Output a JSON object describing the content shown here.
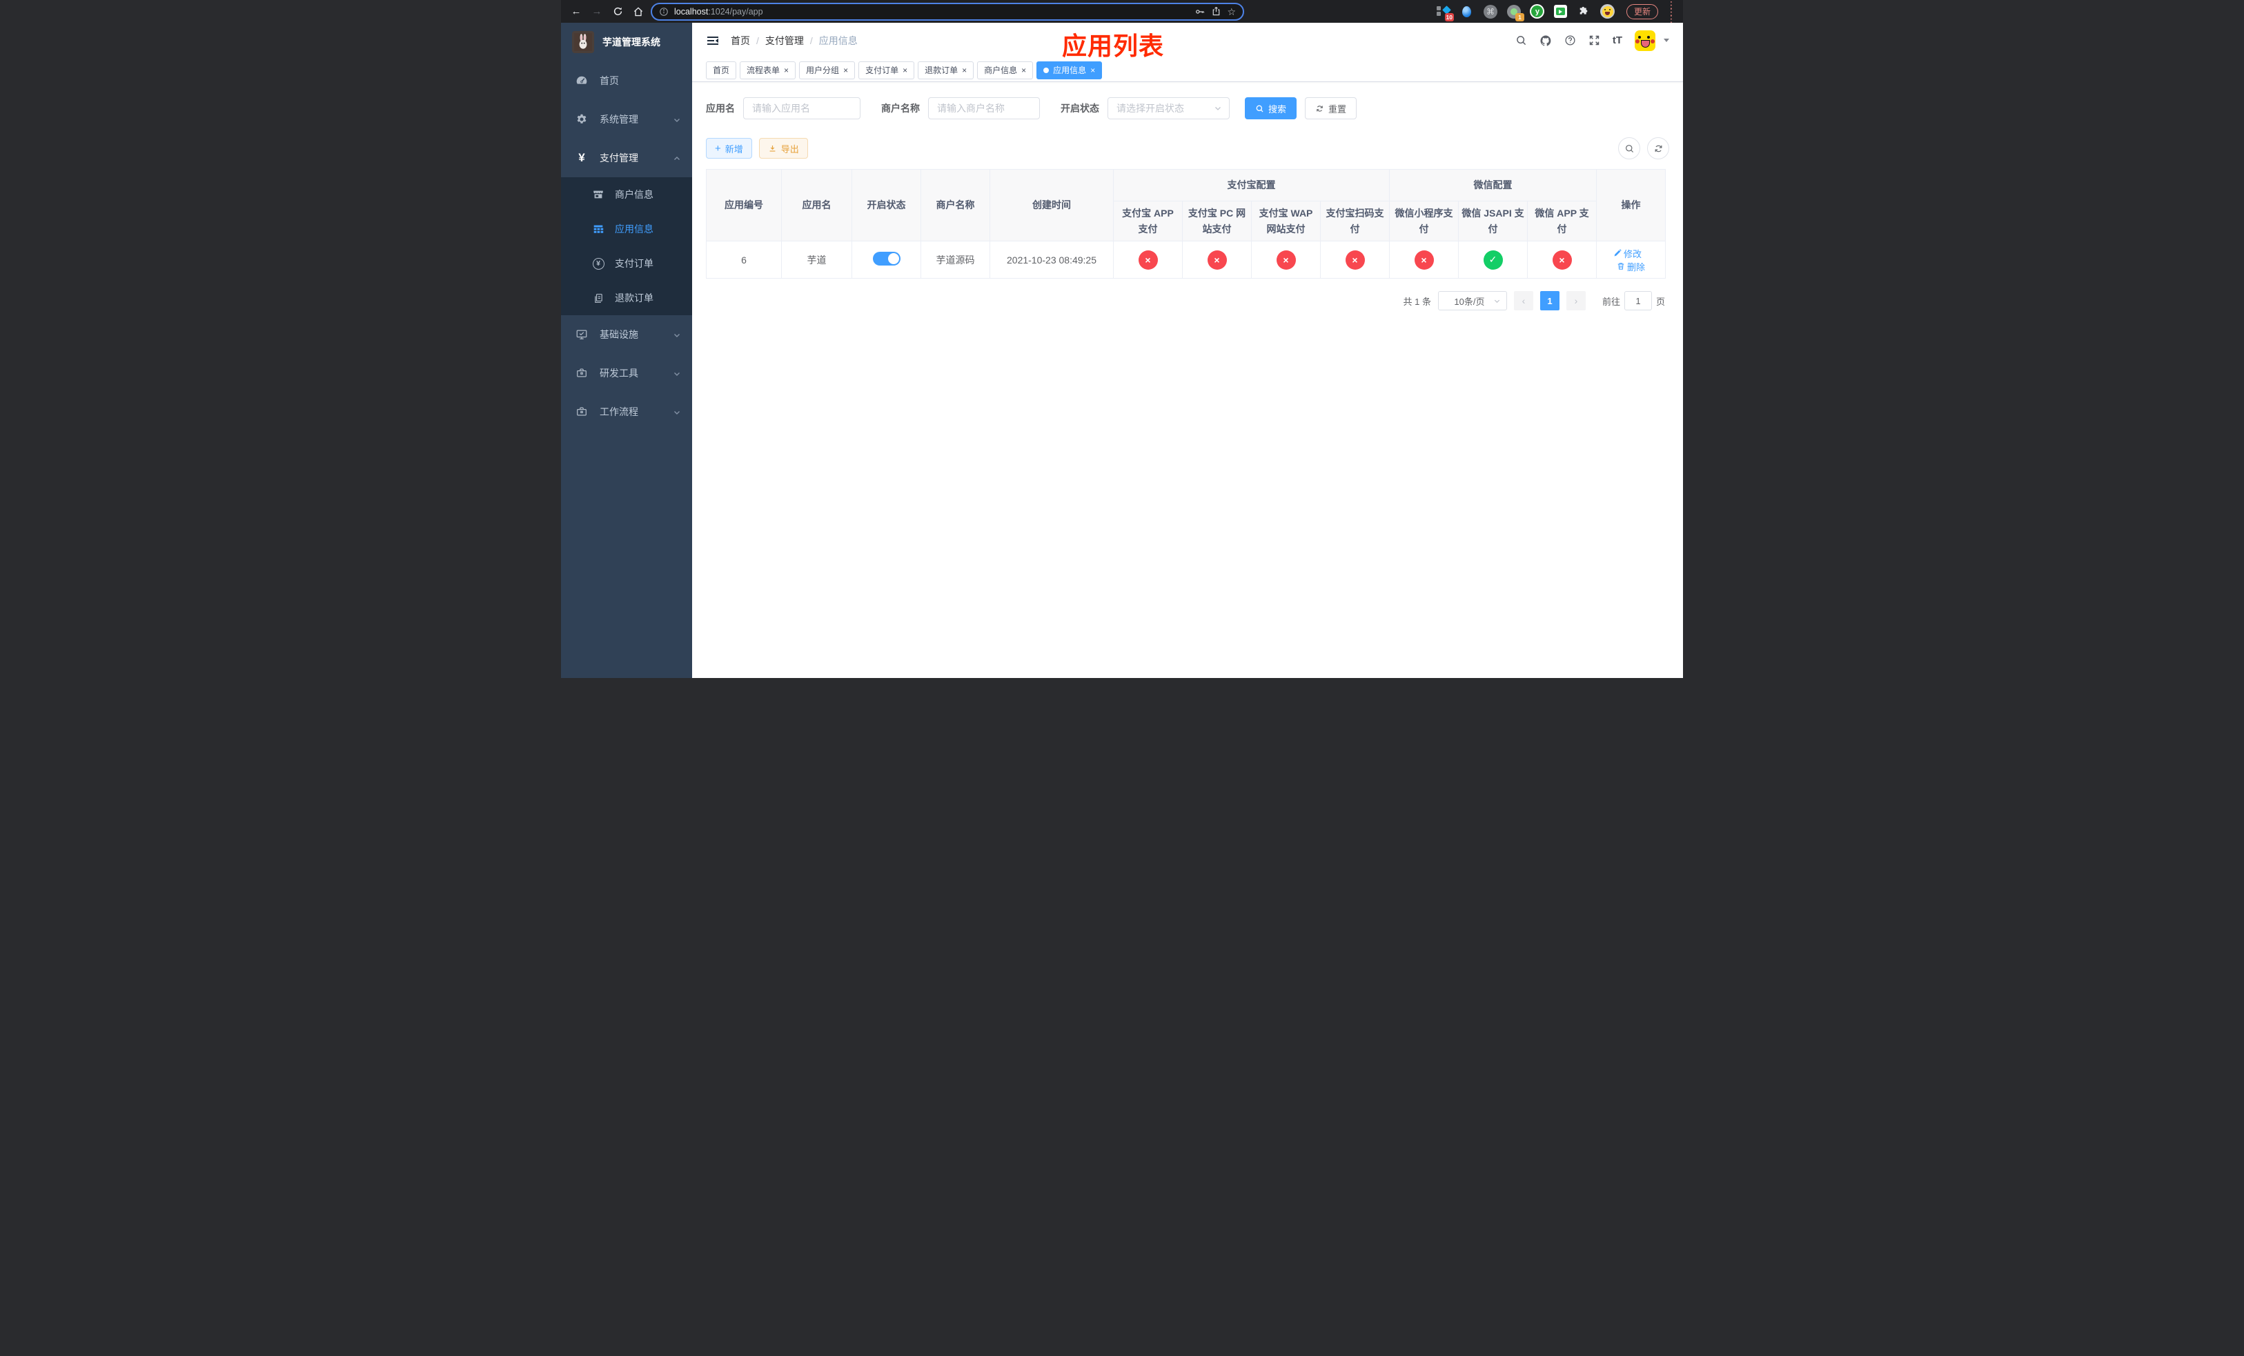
{
  "colors": {
    "primary": "#409EFF",
    "success": "#13CE66",
    "danger": "#F8474F",
    "warning": "#E6A23C",
    "annotation": "#FF2B00",
    "sidebar_bg": "#304156",
    "submenu_bg": "#1F2D3D",
    "chrome_bg": "#202124"
  },
  "browser": {
    "url_host": "localhost",
    "url_rest": ":1024/pay/app",
    "update_label": "更新",
    "extensions": {
      "badge_first": "10",
      "badge_target": "1",
      "y_letter": "y",
      "cmd_glyph": "⌘"
    }
  },
  "sidebar": {
    "title": "芋道管理系统",
    "items": [
      {
        "label": "首页"
      },
      {
        "label": "系统管理"
      },
      {
        "label": "支付管理"
      },
      {
        "label": "基础设施"
      },
      {
        "label": "研发工具"
      },
      {
        "label": "工作流程"
      }
    ],
    "pay_children": [
      {
        "label": "商户信息"
      },
      {
        "label": "应用信息"
      },
      {
        "label": "支付订单"
      },
      {
        "label": "退款订单"
      }
    ],
    "yen_glyph": "¥"
  },
  "header": {
    "breadcrumb": [
      "首页",
      "支付管理",
      "应用信息"
    ],
    "separator": "/",
    "annotation": "应用列表",
    "font_size_label": "tT"
  },
  "tabs": [
    {
      "label": "首页",
      "closable": false,
      "active": false
    },
    {
      "label": "流程表单",
      "closable": true,
      "active": false
    },
    {
      "label": "用户分组",
      "closable": true,
      "active": false
    },
    {
      "label": "支付订单",
      "closable": true,
      "active": false
    },
    {
      "label": "退款订单",
      "closable": true,
      "active": false
    },
    {
      "label": "商户信息",
      "closable": true,
      "active": false
    },
    {
      "label": "应用信息",
      "closable": true,
      "active": true
    }
  ],
  "filters": {
    "app_name_label": "应用名",
    "app_name_placeholder": "请输入应用名",
    "merchant_label": "商户名称",
    "merchant_placeholder": "请输入商户名称",
    "status_label": "开启状态",
    "status_placeholder": "请选择开启状态",
    "search_label": "搜索",
    "reset_label": "重置"
  },
  "toolbar": {
    "add_label": "新增",
    "export_label": "导出",
    "plus_glyph": "+"
  },
  "table": {
    "columns": [
      "应用编号",
      "应用名",
      "开启状态",
      "商户名称",
      "创建时间"
    ],
    "alipay_group": "支付宝配置",
    "alipay_cols": [
      "支付宝 APP 支付",
      "支付宝 PC 网站支付",
      "支付宝 WAP 网站支付",
      "支付宝扫码支付"
    ],
    "wechat_group": "微信配置",
    "wechat_cols": [
      "微信小程序支付",
      "微信 JSAPI 支付",
      "微信 APP 支付"
    ],
    "action_col": "操作",
    "rows": [
      {
        "id": "6",
        "name": "芋道",
        "enabled": true,
        "merchant": "芋道源码",
        "created": "2021-10-23 08:49:25",
        "statuses": [
          false,
          false,
          false,
          false,
          false,
          true,
          false
        ],
        "edit_label": "修改",
        "delete_label": "删除"
      }
    ],
    "status_glyph_ok": "✓",
    "status_glyph_fail": "×"
  },
  "pagination": {
    "total": "共 1 条",
    "page_size": "10条/页",
    "prev": "‹",
    "next": "›",
    "page": "1",
    "goto_label": "前往",
    "goto_value": "1",
    "page_suffix": "页"
  }
}
